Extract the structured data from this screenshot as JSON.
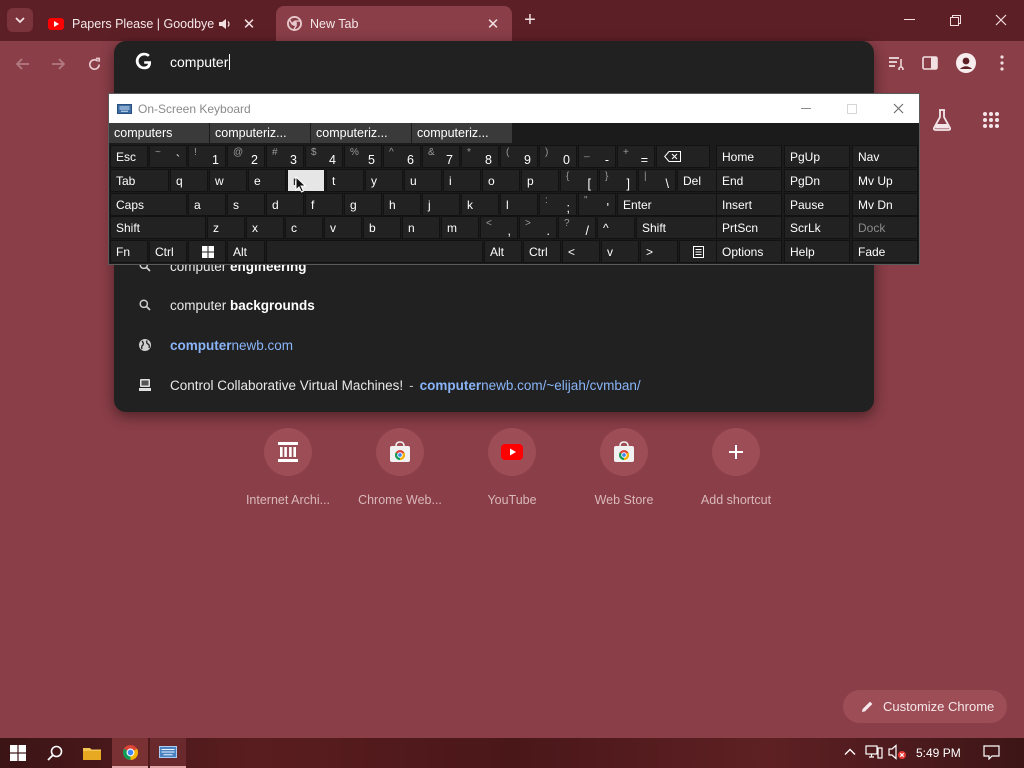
{
  "browser": {
    "tabs": [
      {
        "title": "Papers Please | Goodbye Ins",
        "favicon": "youtube-icon",
        "playing_audio": true
      },
      {
        "title": "New Tab",
        "favicon": "chrome-icon",
        "active": true
      }
    ]
  },
  "omnibox": {
    "input_value": "computer",
    "search_engine_icon": "google-g-icon",
    "suggestions": [
      {
        "icon": "search-icon",
        "prefix": "computer ",
        "bold": "engineering",
        "suffix": ""
      },
      {
        "icon": "search-icon",
        "prefix": "computer ",
        "bold": "backgrounds",
        "suffix": ""
      },
      {
        "icon": "globe-icon",
        "prefix": "computer",
        "bold": "",
        "suffix": "newb.com",
        "url": true
      },
      {
        "icon": "site-favicon-icon",
        "title": "Control Collaborative Virtual Machines!",
        "sep": "-",
        "url_bold": "computer",
        "url_rest": "newb.com/~elijah/cvmban/"
      }
    ]
  },
  "shortcuts": [
    {
      "label": "Internet Archi...",
      "icon": "internet-archive-icon"
    },
    {
      "label": "Chrome Web...",
      "icon": "chrome-web-store-icon"
    },
    {
      "label": "YouTube",
      "icon": "youtube-icon"
    },
    {
      "label": "Web Store",
      "icon": "chrome-web-store-icon"
    },
    {
      "label": "Add shortcut",
      "icon": "plus-icon"
    }
  ],
  "customize_label": "Customize Chrome",
  "osk": {
    "title": "On-Screen Keyboard",
    "predictions": [
      "computers",
      "computeriz...",
      "computeriz...",
      "computeriz..."
    ],
    "rows": [
      [
        {
          "m": "Esc"
        },
        {
          "s": "~",
          "m": "`"
        },
        {
          "s": "!",
          "m": "1"
        },
        {
          "s": "@",
          "m": "2"
        },
        {
          "s": "#",
          "m": "3"
        },
        {
          "s": "$",
          "m": "4"
        },
        {
          "s": "%",
          "m": "5"
        },
        {
          "s": "^",
          "m": "6"
        },
        {
          "s": "&",
          "m": "7"
        },
        {
          "s": "*",
          "m": "8"
        },
        {
          "s": "(",
          "m": "9"
        },
        {
          "s": ")",
          "m": "0"
        },
        {
          "s": "_",
          "m": "-"
        },
        {
          "s": "+",
          "m": "="
        },
        {
          "m": "⌫"
        }
      ],
      [
        {
          "m": "Tab"
        },
        {
          "m": "q"
        },
        {
          "m": "w"
        },
        {
          "m": "e"
        },
        {
          "m": "r"
        },
        {
          "m": "t"
        },
        {
          "m": "y"
        },
        {
          "m": "u"
        },
        {
          "m": "i"
        },
        {
          "m": "o"
        },
        {
          "m": "p"
        },
        {
          "s": "{",
          "m": "["
        },
        {
          "s": "}",
          "m": "]"
        },
        {
          "s": "|",
          "m": "\\"
        },
        {
          "m": "Del"
        }
      ],
      [
        {
          "m": "Caps"
        },
        {
          "m": "a"
        },
        {
          "m": "s"
        },
        {
          "m": "d"
        },
        {
          "m": "f"
        },
        {
          "m": "g"
        },
        {
          "m": "h"
        },
        {
          "m": "j"
        },
        {
          "m": "k"
        },
        {
          "m": "l"
        },
        {
          "s": ":",
          "m": ";"
        },
        {
          "s": "\"",
          "m": "'"
        },
        {
          "m": "Enter"
        }
      ],
      [
        {
          "m": "Shift"
        },
        {
          "m": "z"
        },
        {
          "m": "x"
        },
        {
          "m": "c"
        },
        {
          "m": "v"
        },
        {
          "m": "b"
        },
        {
          "m": "n"
        },
        {
          "m": "m"
        },
        {
          "s": "<",
          "m": ","
        },
        {
          "s": ">",
          "m": "."
        },
        {
          "s": "?",
          "m": "/"
        },
        {
          "m": "^"
        },
        {
          "m": "Shift"
        }
      ],
      [
        {
          "m": "Fn"
        },
        {
          "m": "Ctrl"
        },
        {
          "m": "win-logo-icon"
        },
        {
          "m": "Alt"
        },
        {
          "m": ""
        },
        {
          "m": "Alt"
        },
        {
          "m": "Ctrl"
        },
        {
          "m": "<"
        },
        {
          "m": "v"
        },
        {
          "m": ">"
        },
        {
          "m": "context-menu-icon"
        }
      ]
    ],
    "nav_keys": [
      [
        "Home",
        "PgUp",
        "Nav"
      ],
      [
        "End",
        "PgDn",
        "Mv Up"
      ],
      [
        "Insert",
        "Pause",
        "Mv Dn"
      ],
      [
        "PrtScn",
        "ScrLk",
        "Dock"
      ],
      [
        "Options",
        "Help",
        "Fade"
      ]
    ],
    "highlighted_key": "r"
  },
  "taskbar": {
    "time": "5:49 PM"
  },
  "colors": {
    "page_bg": "#8a3e47",
    "tabstrip_bg": "#5d1f26",
    "popup_bg": "#212121",
    "link_blue": "#8ab4f8"
  }
}
